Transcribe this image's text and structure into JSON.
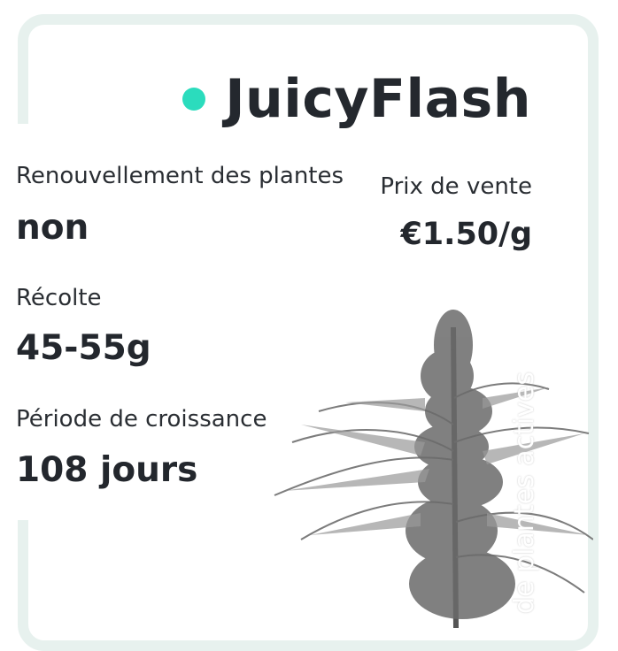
{
  "product": {
    "name": "JuicyFlash",
    "status_color": "#2bdcbd"
  },
  "stats": {
    "renewal_label": "Renouvellement des plantes",
    "renewal_value": "non",
    "price_label": "Prix de vente",
    "price_value": "€1.50/g",
    "harvest_label": "Récolte",
    "harvest_value": "45-55g",
    "growth_label": "Période de croissance",
    "growth_value": "108 jours"
  },
  "side_label": "de plantes actives",
  "image": {
    "icon": "cannabis-plant-image"
  }
}
